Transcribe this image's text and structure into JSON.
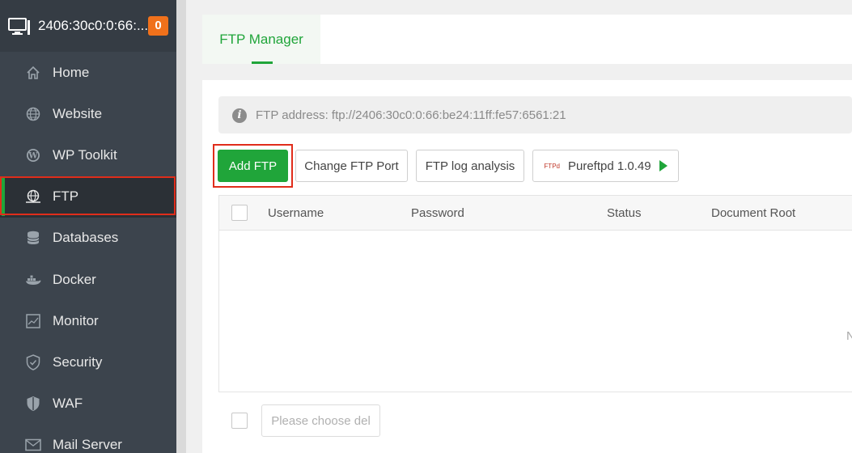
{
  "sidebar": {
    "server_name": "2406:30c0:0:66:...",
    "badge_count": "0",
    "items": [
      {
        "label": "Home",
        "icon": "home-icon"
      },
      {
        "label": "Website",
        "icon": "globe-icon"
      },
      {
        "label": "WP Toolkit",
        "icon": "wordpress-icon"
      },
      {
        "label": "FTP",
        "icon": "ftp-icon",
        "active": true
      },
      {
        "label": "Databases",
        "icon": "database-icon"
      },
      {
        "label": "Docker",
        "icon": "docker-icon"
      },
      {
        "label": "Monitor",
        "icon": "monitor-icon"
      },
      {
        "label": "Security",
        "icon": "shield-icon"
      },
      {
        "label": "WAF",
        "icon": "waf-shield-icon"
      },
      {
        "label": "Mail Server",
        "icon": "mail-icon"
      }
    ]
  },
  "tabs": [
    {
      "label": "FTP Manager",
      "active": true
    }
  ],
  "info": {
    "address": "FTP address: ftp://2406:30c0:0:66:be24:11ff:fe57:6561:21"
  },
  "toolbar": {
    "add_ftp": "Add FTP",
    "change_port": "Change FTP Port",
    "log_analysis": "FTP log analysis",
    "service_logo": "FTPd",
    "service": "Pureftpd 1.0.49"
  },
  "table": {
    "columns": [
      "Username",
      "Password",
      "Status",
      "Document Root"
    ],
    "rows": [],
    "edge_text": "N"
  },
  "footer": {
    "batch_placeholder": "Please choose del"
  },
  "colors": {
    "accent": "#20a53a",
    "highlight": "#e02d1b",
    "badge": "#f0711b",
    "sidebar_bg": "#3c444d"
  }
}
